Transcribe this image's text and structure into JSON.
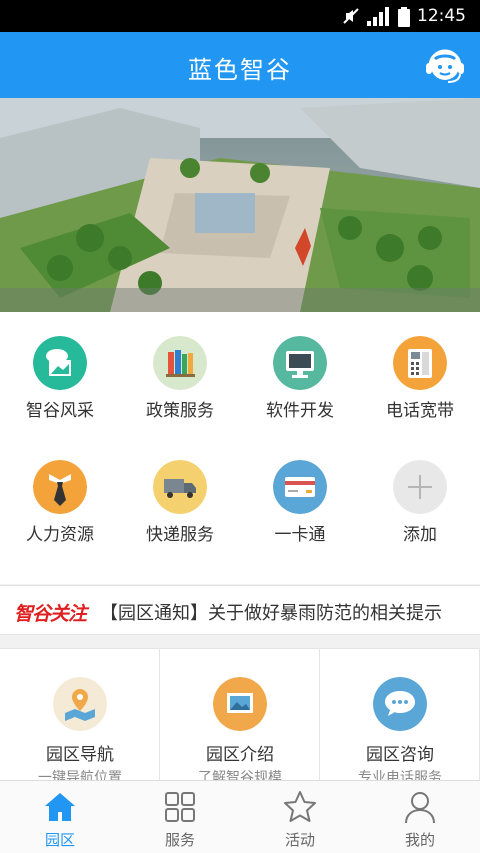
{
  "status_bar": {
    "time": "12:45"
  },
  "header": {
    "title": "蓝色智谷"
  },
  "grid": [
    {
      "label": "智谷风采",
      "icon": "photo-gallery-icon",
      "color": "#26b99a"
    },
    {
      "label": "政策服务",
      "icon": "books-icon",
      "color": "#d8e8cc"
    },
    {
      "label": "软件开发",
      "icon": "monitor-icon",
      "color": "#55b89f"
    },
    {
      "label": "电话宽带",
      "icon": "telephone-icon",
      "color": "#f3a33a"
    },
    {
      "label": "人力资源",
      "icon": "necktie-icon",
      "color": "#f3a33a"
    },
    {
      "label": "快递服务",
      "icon": "delivery-truck-icon",
      "color": "#f4d06f"
    },
    {
      "label": "一卡通",
      "icon": "card-icon",
      "color": "#5aa6d6"
    },
    {
      "label": "添加",
      "icon": "plus-icon",
      "color": "#e8e8e8"
    }
  ],
  "ticker": {
    "brand": "智谷关注",
    "text": "【园区通知】关于做好暴雨防范的相关提示"
  },
  "cards": [
    {
      "title": "园区导航",
      "subtitle": "一键导航位置",
      "icon": "map-pin-icon",
      "color": "#f4ead6"
    },
    {
      "title": "园区介绍",
      "subtitle": "了解智谷规模",
      "icon": "picture-icon",
      "color": "#f0a84a"
    },
    {
      "title": "园区咨询",
      "subtitle": "专业电话服务",
      "icon": "chat-bubble-icon",
      "color": "#5aa6d6"
    }
  ],
  "tabs": [
    {
      "label": "园区",
      "icon": "home-icon",
      "active": true
    },
    {
      "label": "服务",
      "icon": "grid-icon",
      "active": false
    },
    {
      "label": "活动",
      "icon": "star-icon",
      "active": false
    },
    {
      "label": "我的",
      "icon": "user-icon",
      "active": false
    }
  ],
  "colors": {
    "primary": "#2196f3",
    "brand_red": "#e02020"
  }
}
